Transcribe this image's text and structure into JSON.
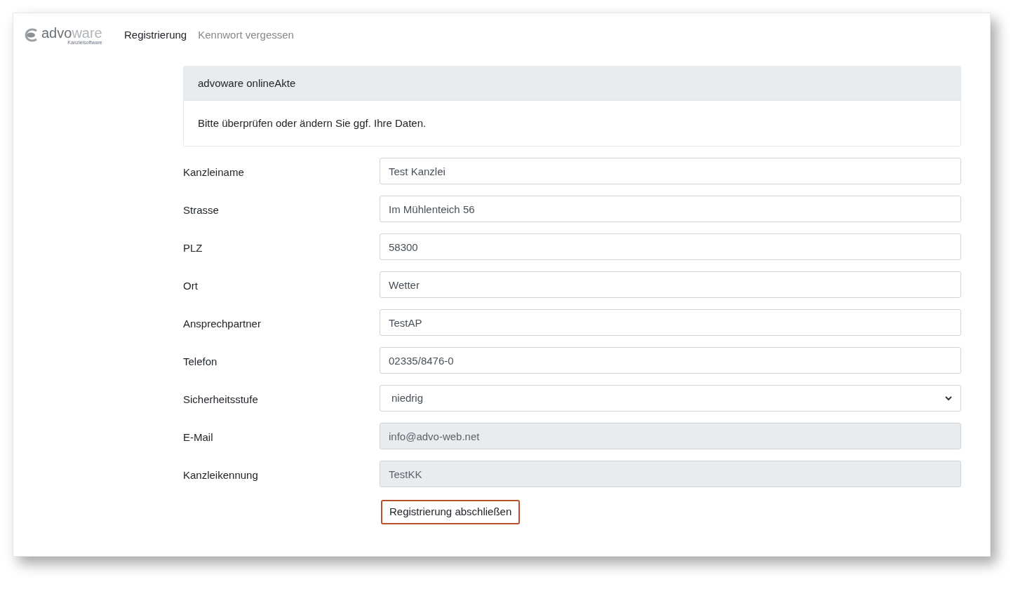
{
  "logo": {
    "name_part_1": "advo",
    "name_part_2": "ware",
    "tagline": "Kanzleisoftware"
  },
  "nav": [
    {
      "label": "Registrierung",
      "selected": true
    },
    {
      "label": "Kennwort vergessen",
      "selected": false
    }
  ],
  "card": {
    "header": "advoware onlineAkte",
    "body": "Bitte überprüfen oder ändern Sie ggf. Ihre Daten."
  },
  "fields": [
    {
      "label": "Kanzleiname",
      "kind": "text",
      "value": "Test Kanzlei",
      "disabled": false
    },
    {
      "label": "Strasse",
      "kind": "text",
      "value": "Im Mühlenteich 56",
      "disabled": false
    },
    {
      "label": "PLZ",
      "kind": "text",
      "value": "58300",
      "disabled": false
    },
    {
      "label": "Ort",
      "kind": "text",
      "value": "Wetter",
      "disabled": false
    },
    {
      "label": "Ansprechpartner",
      "kind": "text",
      "value": "TestAP",
      "disabled": false
    },
    {
      "label": "Telefon",
      "kind": "text",
      "value": "02335/8476-0",
      "disabled": false
    },
    {
      "label": "Sicherheitsstufe",
      "kind": "select",
      "value": "niedrig",
      "disabled": false
    },
    {
      "label": "E-Mail",
      "kind": "text",
      "value": "info@advo-web.net",
      "disabled": true
    },
    {
      "label": "Kanzleikennung",
      "kind": "text",
      "value": "TestKK",
      "disabled": true
    }
  ],
  "submit_button": "Registrierung abschließen"
}
